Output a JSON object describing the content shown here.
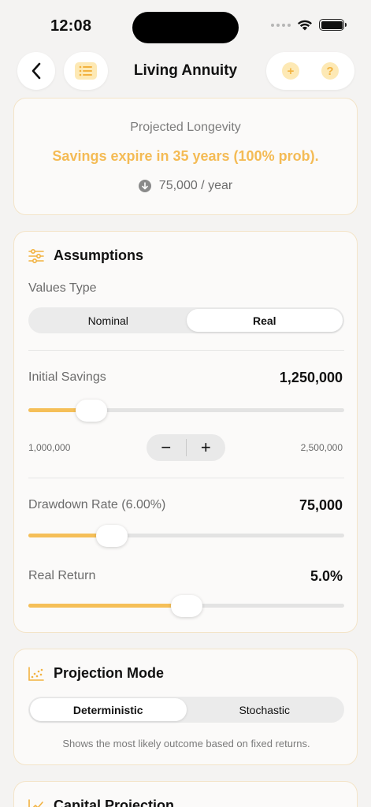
{
  "status_bar": {
    "time": "12:08"
  },
  "nav": {
    "title": "Living Annuity"
  },
  "longevity": {
    "label": "Projected Longevity",
    "headline": "Savings expire in 35 years (100% prob).",
    "amount": "75,000 / year"
  },
  "assumptions": {
    "title": "Assumptions",
    "values_type_label": "Values Type",
    "segments": [
      "Nominal",
      "Real"
    ],
    "selected_segment": "Real",
    "initial_savings": {
      "label": "Initial Savings",
      "value": "1,250,000",
      "min": "1,000,000",
      "max": "2,500,000",
      "level": 0.2
    },
    "stepper": {
      "minus": "−",
      "plus": "+"
    },
    "drawdown": {
      "label": "Drawdown Rate (6.00%)",
      "value": "75,000",
      "level": 0.265
    },
    "real_return": {
      "label": "Real Return",
      "value": "5.0%",
      "level": 0.5
    }
  },
  "projection_mode": {
    "title": "Projection Mode",
    "segments": [
      "Deterministic",
      "Stochastic"
    ],
    "selected_segment": "Deterministic",
    "hint": "Shows the most likely outcome based on fixed returns."
  },
  "capital_projection": {
    "title": "Capital Projection"
  },
  "colors": {
    "accent": "#f5bf58",
    "accent_text": "#f4bb55",
    "card_border": "#f3e4c8"
  }
}
